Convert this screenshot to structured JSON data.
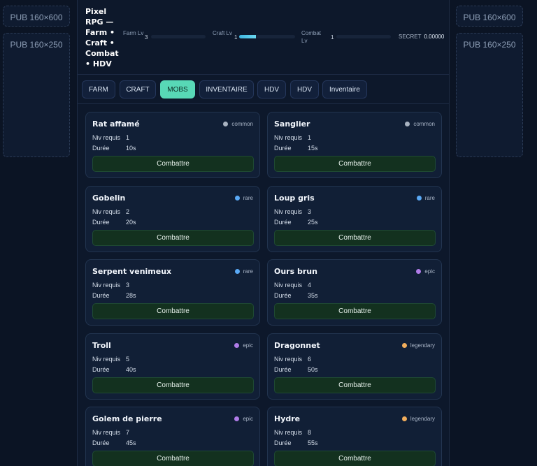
{
  "ads": {
    "left_top": "PUB 160×600",
    "left_bottom": "PUB 160×250",
    "right_top": "PUB 160×600",
    "right_bottom": "PUB 160×250"
  },
  "header": {
    "title": "Pixel RPG — Farm • Craft • Combat • HDV",
    "stats": [
      {
        "label": "Farm Lv",
        "value": "3",
        "progress": 0.0
      },
      {
        "label": "Craft Lv",
        "value": "1",
        "progress": 0.3
      },
      {
        "label": "Combat Lv",
        "value": "1",
        "progress": 0.0
      }
    ],
    "secret_label": "SECRET",
    "secret_value": "0.00000"
  },
  "tabs": [
    "FARM",
    "CRAFT",
    "MOBS",
    "INVENTAIRE",
    "HDV",
    "HDV",
    "Inventaire"
  ],
  "active_tab": 2,
  "labels": {
    "level": "Niv requis",
    "duration": "Durée",
    "fight": "Combattre"
  },
  "rarity_colors": {
    "common": "#a9b3c1",
    "rare": "#5aa9f5",
    "epic": "#b07ce8",
    "legendary": "#f1ad5c"
  },
  "mobs": [
    {
      "name": "Rat affamé",
      "rarity": "common",
      "level": "1",
      "duration": "10s"
    },
    {
      "name": "Sanglier",
      "rarity": "common",
      "level": "1",
      "duration": "15s"
    },
    {
      "name": "Gobelin",
      "rarity": "rare",
      "level": "2",
      "duration": "20s"
    },
    {
      "name": "Loup gris",
      "rarity": "rare",
      "level": "3",
      "duration": "25s"
    },
    {
      "name": "Serpent venimeux",
      "rarity": "rare",
      "level": "3",
      "duration": "28s"
    },
    {
      "name": "Ours brun",
      "rarity": "epic",
      "level": "4",
      "duration": "35s"
    },
    {
      "name": "Troll",
      "rarity": "epic",
      "level": "5",
      "duration": "40s"
    },
    {
      "name": "Dragonnet",
      "rarity": "legendary",
      "level": "6",
      "duration": "50s"
    },
    {
      "name": "Golem de pierre",
      "rarity": "epic",
      "level": "7",
      "duration": "45s"
    },
    {
      "name": "Hydre",
      "rarity": "legendary",
      "level": "8",
      "duration": "55s"
    }
  ]
}
